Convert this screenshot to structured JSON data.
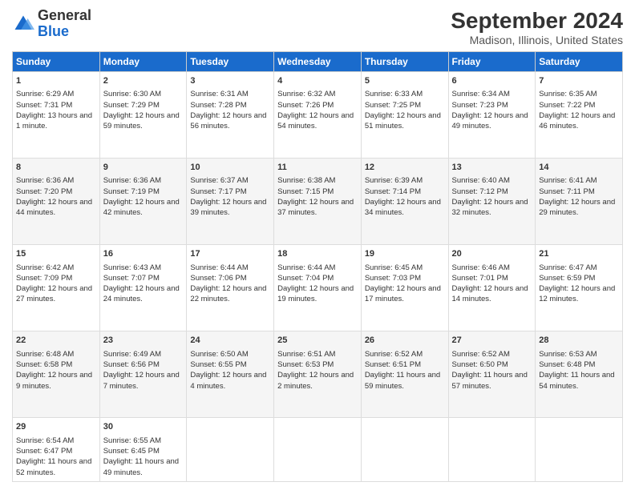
{
  "logo": {
    "general": "General",
    "blue": "Blue"
  },
  "title": "September 2024",
  "subtitle": "Madison, Illinois, United States",
  "headers": [
    "Sunday",
    "Monday",
    "Tuesday",
    "Wednesday",
    "Thursday",
    "Friday",
    "Saturday"
  ],
  "weeks": [
    [
      {
        "day": "1",
        "sunrise": "Sunrise: 6:29 AM",
        "sunset": "Sunset: 7:31 PM",
        "daylight": "Daylight: 13 hours and 1 minute."
      },
      {
        "day": "2",
        "sunrise": "Sunrise: 6:30 AM",
        "sunset": "Sunset: 7:29 PM",
        "daylight": "Daylight: 12 hours and 59 minutes."
      },
      {
        "day": "3",
        "sunrise": "Sunrise: 6:31 AM",
        "sunset": "Sunset: 7:28 PM",
        "daylight": "Daylight: 12 hours and 56 minutes."
      },
      {
        "day": "4",
        "sunrise": "Sunrise: 6:32 AM",
        "sunset": "Sunset: 7:26 PM",
        "daylight": "Daylight: 12 hours and 54 minutes."
      },
      {
        "day": "5",
        "sunrise": "Sunrise: 6:33 AM",
        "sunset": "Sunset: 7:25 PM",
        "daylight": "Daylight: 12 hours and 51 minutes."
      },
      {
        "day": "6",
        "sunrise": "Sunrise: 6:34 AM",
        "sunset": "Sunset: 7:23 PM",
        "daylight": "Daylight: 12 hours and 49 minutes."
      },
      {
        "day": "7",
        "sunrise": "Sunrise: 6:35 AM",
        "sunset": "Sunset: 7:22 PM",
        "daylight": "Daylight: 12 hours and 46 minutes."
      }
    ],
    [
      {
        "day": "8",
        "sunrise": "Sunrise: 6:36 AM",
        "sunset": "Sunset: 7:20 PM",
        "daylight": "Daylight: 12 hours and 44 minutes."
      },
      {
        "day": "9",
        "sunrise": "Sunrise: 6:36 AM",
        "sunset": "Sunset: 7:19 PM",
        "daylight": "Daylight: 12 hours and 42 minutes."
      },
      {
        "day": "10",
        "sunrise": "Sunrise: 6:37 AM",
        "sunset": "Sunset: 7:17 PM",
        "daylight": "Daylight: 12 hours and 39 minutes."
      },
      {
        "day": "11",
        "sunrise": "Sunrise: 6:38 AM",
        "sunset": "Sunset: 7:15 PM",
        "daylight": "Daylight: 12 hours and 37 minutes."
      },
      {
        "day": "12",
        "sunrise": "Sunrise: 6:39 AM",
        "sunset": "Sunset: 7:14 PM",
        "daylight": "Daylight: 12 hours and 34 minutes."
      },
      {
        "day": "13",
        "sunrise": "Sunrise: 6:40 AM",
        "sunset": "Sunset: 7:12 PM",
        "daylight": "Daylight: 12 hours and 32 minutes."
      },
      {
        "day": "14",
        "sunrise": "Sunrise: 6:41 AM",
        "sunset": "Sunset: 7:11 PM",
        "daylight": "Daylight: 12 hours and 29 minutes."
      }
    ],
    [
      {
        "day": "15",
        "sunrise": "Sunrise: 6:42 AM",
        "sunset": "Sunset: 7:09 PM",
        "daylight": "Daylight: 12 hours and 27 minutes."
      },
      {
        "day": "16",
        "sunrise": "Sunrise: 6:43 AM",
        "sunset": "Sunset: 7:07 PM",
        "daylight": "Daylight: 12 hours and 24 minutes."
      },
      {
        "day": "17",
        "sunrise": "Sunrise: 6:44 AM",
        "sunset": "Sunset: 7:06 PM",
        "daylight": "Daylight: 12 hours and 22 minutes."
      },
      {
        "day": "18",
        "sunrise": "Sunrise: 6:44 AM",
        "sunset": "Sunset: 7:04 PM",
        "daylight": "Daylight: 12 hours and 19 minutes."
      },
      {
        "day": "19",
        "sunrise": "Sunrise: 6:45 AM",
        "sunset": "Sunset: 7:03 PM",
        "daylight": "Daylight: 12 hours and 17 minutes."
      },
      {
        "day": "20",
        "sunrise": "Sunrise: 6:46 AM",
        "sunset": "Sunset: 7:01 PM",
        "daylight": "Daylight: 12 hours and 14 minutes."
      },
      {
        "day": "21",
        "sunrise": "Sunrise: 6:47 AM",
        "sunset": "Sunset: 6:59 PM",
        "daylight": "Daylight: 12 hours and 12 minutes."
      }
    ],
    [
      {
        "day": "22",
        "sunrise": "Sunrise: 6:48 AM",
        "sunset": "Sunset: 6:58 PM",
        "daylight": "Daylight: 12 hours and 9 minutes."
      },
      {
        "day": "23",
        "sunrise": "Sunrise: 6:49 AM",
        "sunset": "Sunset: 6:56 PM",
        "daylight": "Daylight: 12 hours and 7 minutes."
      },
      {
        "day": "24",
        "sunrise": "Sunrise: 6:50 AM",
        "sunset": "Sunset: 6:55 PM",
        "daylight": "Daylight: 12 hours and 4 minutes."
      },
      {
        "day": "25",
        "sunrise": "Sunrise: 6:51 AM",
        "sunset": "Sunset: 6:53 PM",
        "daylight": "Daylight: 12 hours and 2 minutes."
      },
      {
        "day": "26",
        "sunrise": "Sunrise: 6:52 AM",
        "sunset": "Sunset: 6:51 PM",
        "daylight": "Daylight: 11 hours and 59 minutes."
      },
      {
        "day": "27",
        "sunrise": "Sunrise: 6:52 AM",
        "sunset": "Sunset: 6:50 PM",
        "daylight": "Daylight: 11 hours and 57 minutes."
      },
      {
        "day": "28",
        "sunrise": "Sunrise: 6:53 AM",
        "sunset": "Sunset: 6:48 PM",
        "daylight": "Daylight: 11 hours and 54 minutes."
      }
    ],
    [
      {
        "day": "29",
        "sunrise": "Sunrise: 6:54 AM",
        "sunset": "Sunset: 6:47 PM",
        "daylight": "Daylight: 11 hours and 52 minutes."
      },
      {
        "day": "30",
        "sunrise": "Sunrise: 6:55 AM",
        "sunset": "Sunset: 6:45 PM",
        "daylight": "Daylight: 11 hours and 49 minutes."
      },
      {
        "day": "",
        "sunrise": "",
        "sunset": "",
        "daylight": ""
      },
      {
        "day": "",
        "sunrise": "",
        "sunset": "",
        "daylight": ""
      },
      {
        "day": "",
        "sunrise": "",
        "sunset": "",
        "daylight": ""
      },
      {
        "day": "",
        "sunrise": "",
        "sunset": "",
        "daylight": ""
      },
      {
        "day": "",
        "sunrise": "",
        "sunset": "",
        "daylight": ""
      }
    ]
  ]
}
